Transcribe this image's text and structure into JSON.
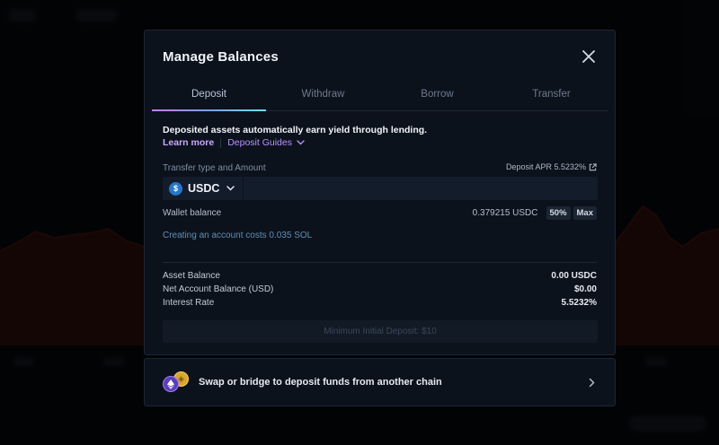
{
  "modal": {
    "title": "Manage Balances",
    "tabs": [
      {
        "label": "Deposit",
        "active": true
      },
      {
        "label": "Withdraw",
        "active": false
      },
      {
        "label": "Borrow",
        "active": false
      },
      {
        "label": "Transfer",
        "active": false
      }
    ],
    "info_text": "Deposited assets automatically earn yield through lending.",
    "learn_more": "Learn more",
    "deposit_guides": "Deposit Guides",
    "transfer_label": "Transfer type and Amount",
    "deposit_apr": "Deposit APR 5.5232%",
    "token": {
      "symbol": "USDC",
      "icon": "usdc-icon"
    },
    "amount_input": {
      "value": "",
      "placeholder": ""
    },
    "wallet_balance": {
      "label": "Wallet balance",
      "value": "0.379215 USDC",
      "half_label": "50%",
      "max_label": "Max"
    },
    "account_cost_note": "Creating an account costs 0.035 SOL",
    "stats": [
      {
        "label": "Asset Balance",
        "value": "0.00 USDC"
      },
      {
        "label": "Net Account Balance (USD)",
        "value": "$0.00"
      },
      {
        "label": "Interest Rate",
        "value": "5.5232%"
      }
    ],
    "submit_button": "Minimum Initial Deposit: $10"
  },
  "bridge": {
    "text": "Swap or bridge to deposit funds from another chain"
  },
  "colors": {
    "modal_bg": "#0c121c",
    "accent_purple": "#b891ff",
    "note_blue": "#5f8fb3",
    "usdc_blue": "#2775ca"
  }
}
